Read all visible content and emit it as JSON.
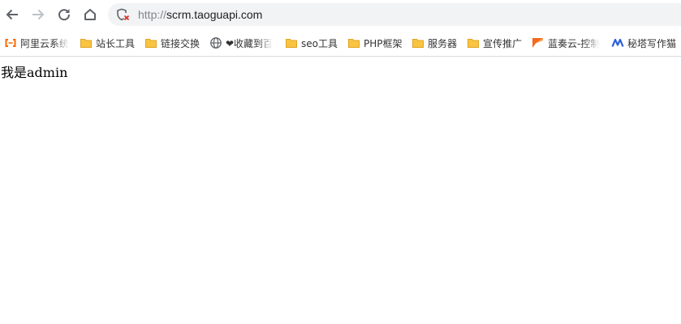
{
  "address_bar": {
    "url_scheme": "http://",
    "url_host": "scrm.taoguapi.com",
    "security_state": "not-secure"
  },
  "navigation": {
    "back_icon": "arrow-left",
    "forward_icon": "arrow-right (disabled)",
    "reload_icon": "reload",
    "home_icon": "home"
  },
  "bookmarks": [
    {
      "label": "阿里云系统",
      "icon": "aliyun-logo"
    },
    {
      "label": "站长工具",
      "icon": "folder"
    },
    {
      "label": "链接交换",
      "icon": "folder"
    },
    {
      "label": "❤收藏到百",
      "icon": "globe"
    },
    {
      "label": "seo工具",
      "icon": "folder"
    },
    {
      "label": "PHP框架",
      "icon": "folder"
    },
    {
      "label": "服务器",
      "icon": "folder"
    },
    {
      "label": "宣传推广",
      "icon": "folder"
    },
    {
      "label": "蓝奏云-控制",
      "icon": "lanzou-logo"
    },
    {
      "label": "秘塔写作猫",
      "icon": "metaso-logo"
    }
  ],
  "page": {
    "content": "我是admin"
  },
  "colors": {
    "folder": "#f9c441",
    "aliyun": "#ff6a00",
    "warning_red": "#d93025",
    "url_muted": "#80868b"
  }
}
